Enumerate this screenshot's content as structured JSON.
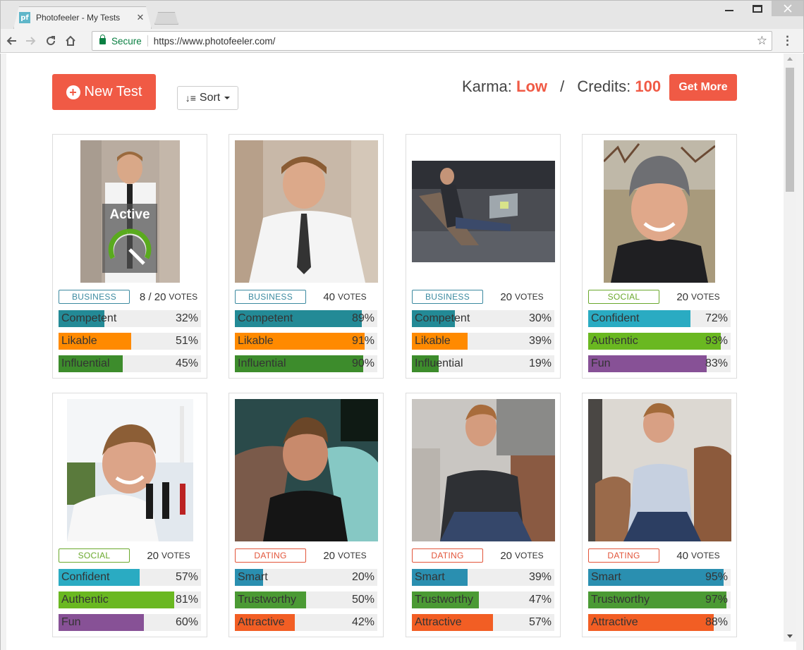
{
  "browser": {
    "tab_title": "Photofeeler - My Tests",
    "favicon_text": "pf",
    "tab_close": "✕",
    "secure_label": "Secure",
    "url": "https://www.photofeeler.com/"
  },
  "header": {
    "new_test_label": "New Test",
    "sort_label": "Sort",
    "karma_label": "Karma:",
    "karma_value": "Low",
    "credits_label": "Credits:",
    "credits_value": "100",
    "get_more_label": "Get More"
  },
  "colors": {
    "accent": "#f05a45",
    "business": "#3c8aa0",
    "social": "#6aa82c",
    "dating": "#e2553a"
  },
  "cards": [
    {
      "category": "BUSINESS",
      "votes": "8 / 20",
      "votes_label": "VOTES",
      "status": "Active",
      "status_progress": 0.4,
      "traits": [
        {
          "name": "Competent",
          "pct": "32%",
          "value": 32,
          "color": "#238a96"
        },
        {
          "name": "Likable",
          "pct": "51%",
          "value": 51,
          "color": "#ff8a00"
        },
        {
          "name": "Influential",
          "pct": "45%",
          "value": 45,
          "color": "#3d8c2c"
        }
      ]
    },
    {
      "category": "BUSINESS",
      "votes": "40",
      "votes_label": "VOTES",
      "traits": [
        {
          "name": "Competent",
          "pct": "89%",
          "value": 89,
          "color": "#238a96"
        },
        {
          "name": "Likable",
          "pct": "91%",
          "value": 91,
          "color": "#ff8a00"
        },
        {
          "name": "Influential",
          "pct": "90%",
          "value": 90,
          "color": "#3d8c2c"
        }
      ]
    },
    {
      "category": "BUSINESS",
      "votes": "20",
      "votes_label": "VOTES",
      "traits": [
        {
          "name": "Competent",
          "pct": "30%",
          "value": 30,
          "color": "#238a96"
        },
        {
          "name": "Likable",
          "pct": "39%",
          "value": 39,
          "color": "#ff8a00"
        },
        {
          "name": "Influential",
          "pct": "19%",
          "value": 19,
          "color": "#3d8c2c"
        }
      ]
    },
    {
      "category": "SOCIAL",
      "votes": "20",
      "votes_label": "VOTES",
      "traits": [
        {
          "name": "Confident",
          "pct": "72%",
          "value": 72,
          "color": "#2aabc2"
        },
        {
          "name": "Authentic",
          "pct": "93%",
          "value": 93,
          "color": "#6ab821"
        },
        {
          "name": "Fun",
          "pct": "83%",
          "value": 83,
          "color": "#875196"
        }
      ]
    },
    {
      "category": "SOCIAL",
      "votes": "20",
      "votes_label": "VOTES",
      "traits": [
        {
          "name": "Confident",
          "pct": "57%",
          "value": 57,
          "color": "#2aabc2"
        },
        {
          "name": "Authentic",
          "pct": "81%",
          "value": 81,
          "color": "#6ab821"
        },
        {
          "name": "Fun",
          "pct": "60%",
          "value": 60,
          "color": "#875196"
        }
      ]
    },
    {
      "category": "DATING",
      "votes": "20",
      "votes_label": "VOTES",
      "traits": [
        {
          "name": "Smart",
          "pct": "20%",
          "value": 20,
          "color": "#2a8fb0"
        },
        {
          "name": "Trustworthy",
          "pct": "50%",
          "value": 50,
          "color": "#4b9a34"
        },
        {
          "name": "Attractive",
          "pct": "42%",
          "value": 42,
          "color": "#f25e24"
        }
      ]
    },
    {
      "category": "DATING",
      "votes": "20",
      "votes_label": "VOTES",
      "traits": [
        {
          "name": "Smart",
          "pct": "39%",
          "value": 39,
          "color": "#2a8fb0"
        },
        {
          "name": "Trustworthy",
          "pct": "47%",
          "value": 47,
          "color": "#4b9a34"
        },
        {
          "name": "Attractive",
          "pct": "57%",
          "value": 57,
          "color": "#f25e24"
        }
      ]
    },
    {
      "category": "DATING",
      "votes": "40",
      "votes_label": "VOTES",
      "traits": [
        {
          "name": "Smart",
          "pct": "95%",
          "value": 95,
          "color": "#2a8fb0"
        },
        {
          "name": "Trustworthy",
          "pct": "97%",
          "value": 97,
          "color": "#4b9a34"
        },
        {
          "name": "Attractive",
          "pct": "88%",
          "value": 88,
          "color": "#f25e24"
        }
      ]
    }
  ]
}
